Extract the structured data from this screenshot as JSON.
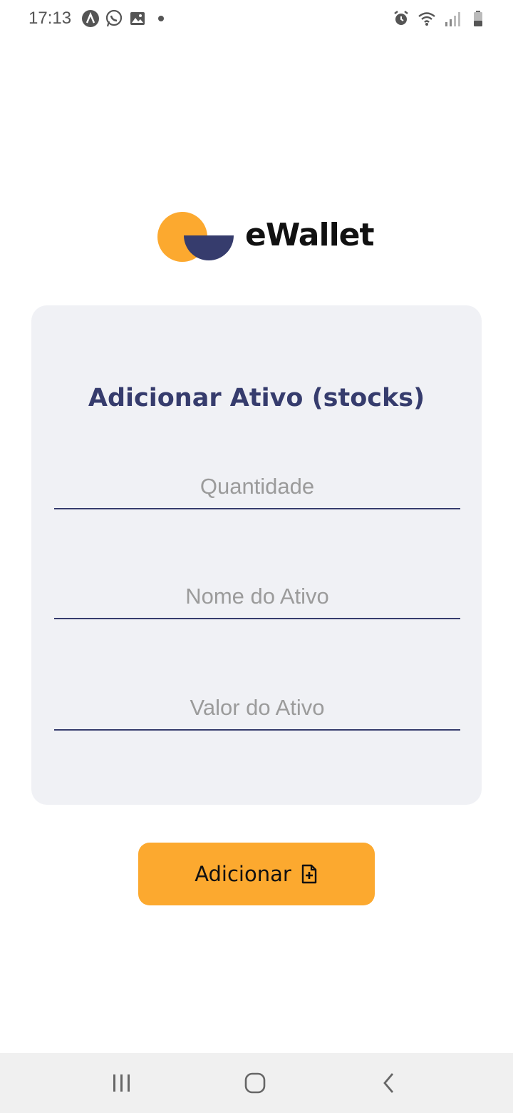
{
  "status_bar": {
    "time": "17:13",
    "left_icons": [
      "arc-app-icon",
      "whatsapp-icon",
      "gallery-icon",
      "dot-icon"
    ],
    "right_icons": [
      "alarm-icon",
      "wifi-icon",
      "signal-icon",
      "battery-icon"
    ]
  },
  "logo": {
    "text": "eWallet",
    "colors": {
      "orange": "#FCA92F",
      "navy": "#363C6D"
    }
  },
  "card": {
    "title": "Adicionar Ativo (stocks)",
    "fields": [
      {
        "placeholder": "Quantidade",
        "value": ""
      },
      {
        "placeholder": "Nome do Ativo",
        "value": ""
      },
      {
        "placeholder": "Valor do Ativo",
        "value": ""
      }
    ]
  },
  "button": {
    "label": "Adicionar",
    "icon": "file-plus-icon",
    "color": "#FCA92F"
  },
  "nav_bar": {
    "items": [
      "recents-icon",
      "home-icon",
      "back-icon"
    ]
  }
}
